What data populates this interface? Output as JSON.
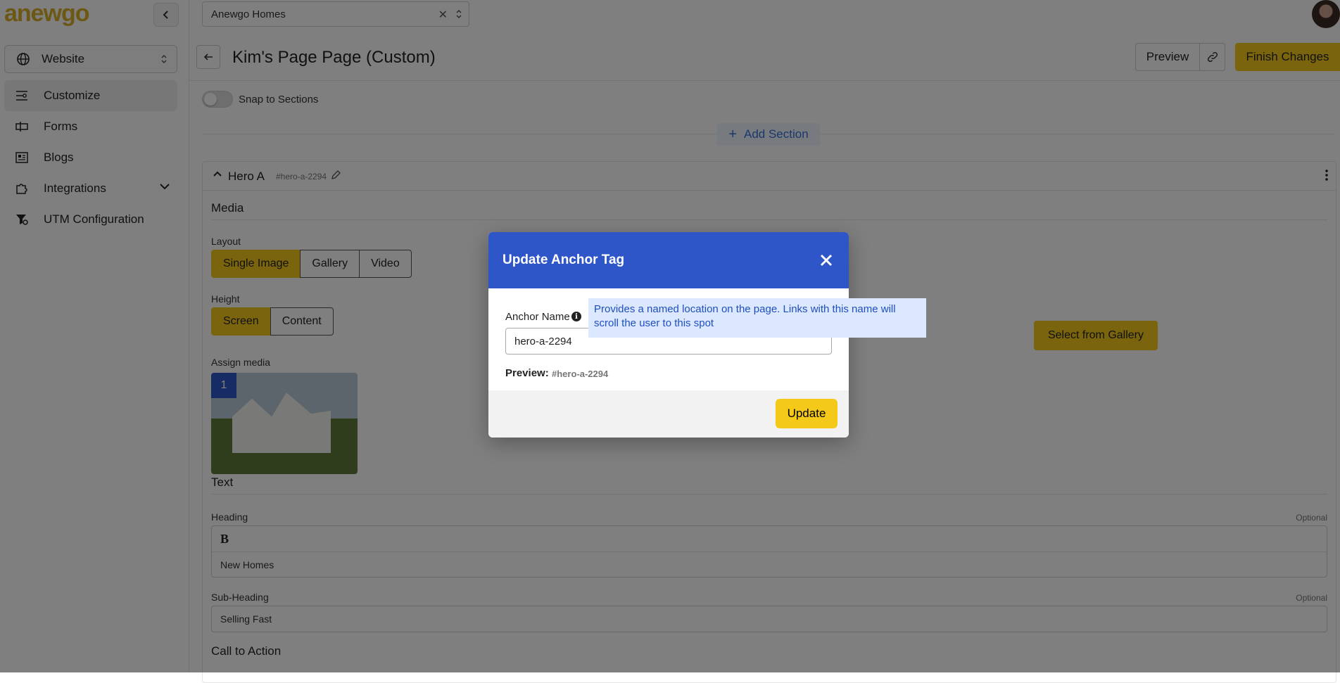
{
  "brand": {
    "logo_text": "anewgo",
    "accent": "#f5c91a",
    "primary": "#2f56c8"
  },
  "sidebar": {
    "site_select": {
      "label": "Website",
      "icon": "globe-icon"
    },
    "items": [
      {
        "label": "Customize",
        "icon": "sliders-icon",
        "active": true
      },
      {
        "label": "Forms",
        "icon": "form-icon"
      },
      {
        "label": "Blogs",
        "icon": "newspaper-icon"
      },
      {
        "label": "Integrations",
        "icon": "puzzle-icon",
        "has_chevron": true
      },
      {
        "label": "UTM Configuration",
        "icon": "filter-gear-icon"
      }
    ]
  },
  "topbar": {
    "builder_select": {
      "value": "Anewgo Homes",
      "clear_symbol": "✕"
    }
  },
  "page": {
    "title": "Kim's Page Page (Custom)",
    "preview_label": "Preview",
    "finish_label": "Finish Changes"
  },
  "content": {
    "snap_label": "Snap to Sections",
    "add_section_label": "Add Section",
    "section": {
      "name": "Hero A",
      "anchor": "#hero-a-2294",
      "media_title": "Media",
      "layout_label": "Layout",
      "layout_options": [
        "Single Image",
        "Gallery",
        "Video"
      ],
      "layout_selected": "Single Image",
      "height_label": "Height",
      "height_options": [
        "Screen",
        "Content"
      ],
      "height_selected": "Screen",
      "assign_media_label": "Assign media",
      "media_index": "1",
      "gallery_button": "Select from Gallery",
      "text_title": "Text",
      "heading_label": "Heading",
      "heading_optional": "Optional",
      "heading_toolbar_b": "B",
      "heading_value": "New Homes",
      "subheading_label": "Sub-Heading",
      "subheading_optional": "Optional",
      "subheading_value": "Selling Fast",
      "cta_label": "Call to Action"
    }
  },
  "modal": {
    "title": "Update Anchor Tag",
    "anchor_name_label": "Anchor Name",
    "anchor_value": "hero-a-2294",
    "preview_label": "Preview:",
    "preview_value": "#hero-a-2294",
    "update_label": "Update",
    "tooltip": "Provides a named location on the page. Links with this name will scroll the user to this spot"
  }
}
